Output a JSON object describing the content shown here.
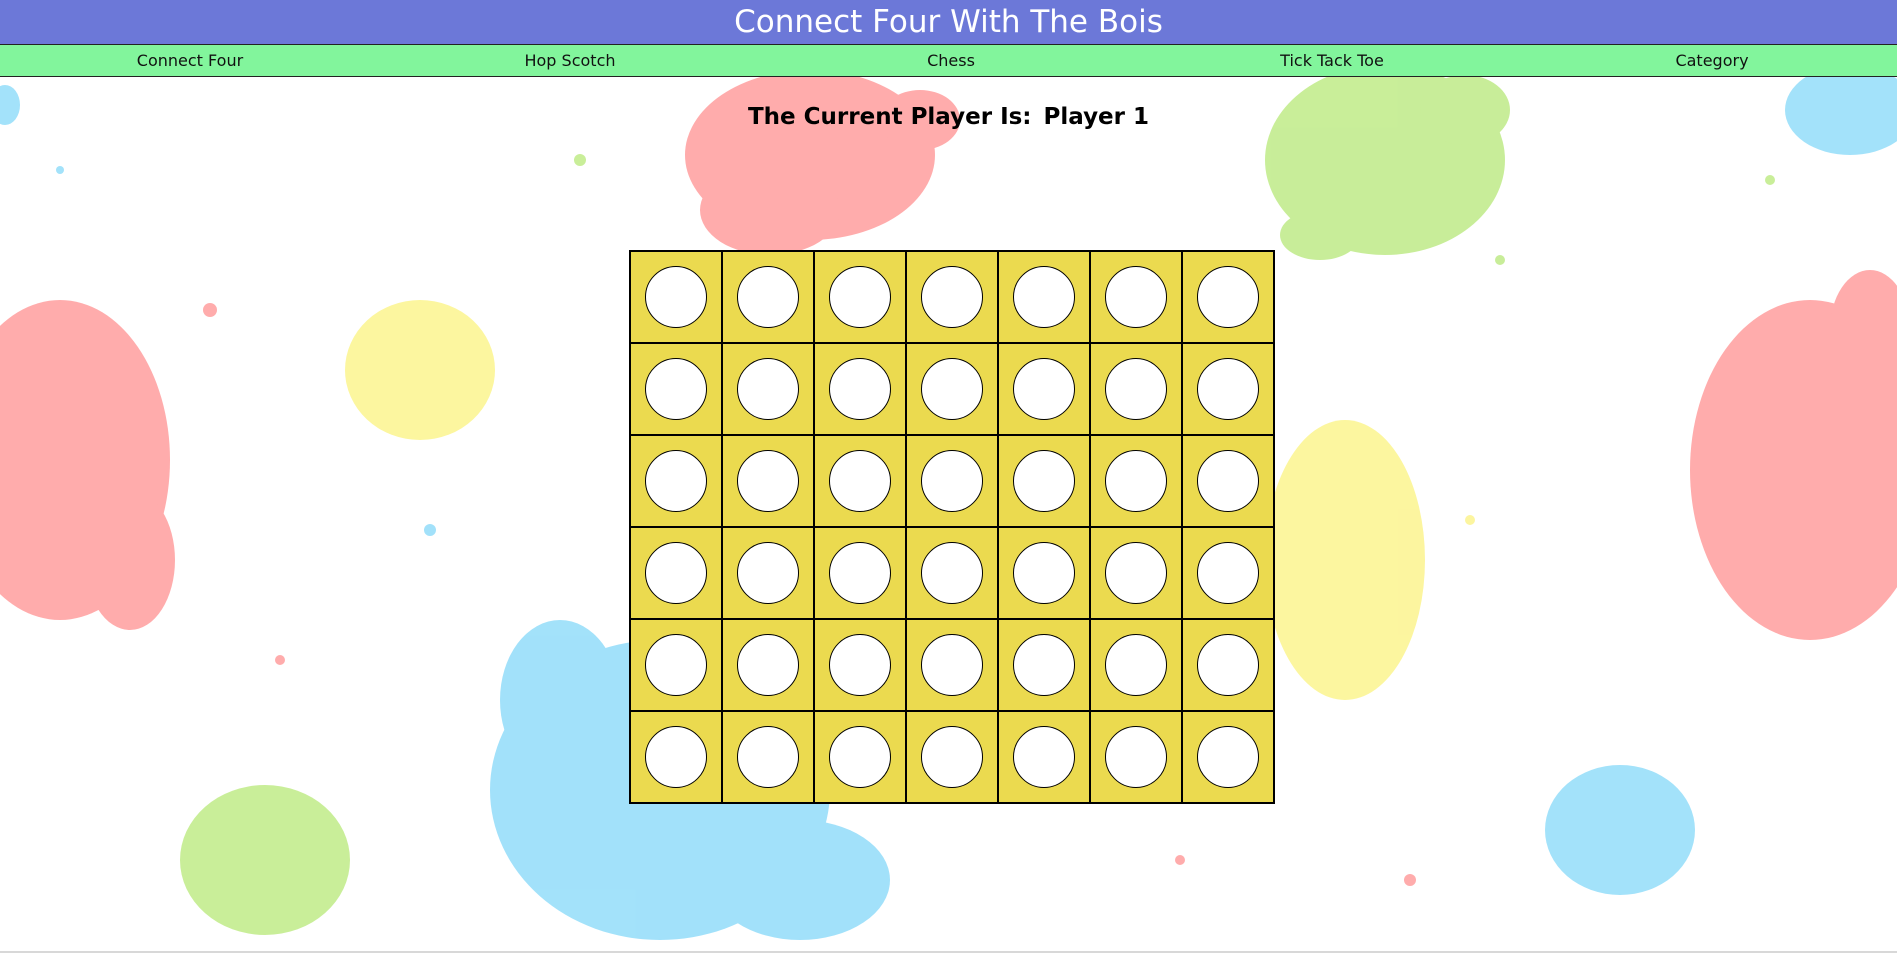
{
  "header": {
    "title": "Connect Four With The Bois"
  },
  "nav": {
    "items": [
      {
        "label": "Connect Four"
      },
      {
        "label": "Hop Scotch"
      },
      {
        "label": "Chess"
      },
      {
        "label": "Tick Tack Toe"
      },
      {
        "label": "Category"
      }
    ]
  },
  "status": {
    "prefix": "The Current Player Is:",
    "player": "Player 1"
  },
  "board": {
    "rows": 6,
    "columns": 7,
    "cells": [
      [
        "empty",
        "empty",
        "empty",
        "empty",
        "empty",
        "empty",
        "empty"
      ],
      [
        "empty",
        "empty",
        "empty",
        "empty",
        "empty",
        "empty",
        "empty"
      ],
      [
        "empty",
        "empty",
        "empty",
        "empty",
        "empty",
        "empty",
        "empty"
      ],
      [
        "empty",
        "empty",
        "empty",
        "empty",
        "empty",
        "empty",
        "empty"
      ],
      [
        "empty",
        "empty",
        "empty",
        "empty",
        "empty",
        "empty",
        "empty"
      ],
      [
        "empty",
        "empty",
        "empty",
        "empty",
        "empty",
        "empty",
        "empty"
      ]
    ]
  },
  "colors": {
    "header_bg": "#6c78d8",
    "nav_bg": "#82f59c",
    "board_bg": "#ebda4f",
    "disc_empty": "#ffffff"
  }
}
